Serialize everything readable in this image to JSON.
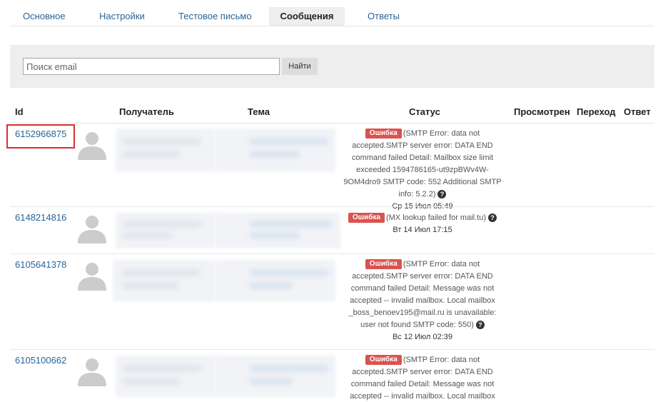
{
  "tabs": [
    {
      "label": "Основное"
    },
    {
      "label": "Настройки"
    },
    {
      "label": "Тестовое письмо"
    },
    {
      "label": "Сообщения"
    },
    {
      "label": "Ответы"
    }
  ],
  "search": {
    "placeholder": "Поиск email",
    "value": "",
    "button_label": "Найти"
  },
  "table": {
    "columns": [
      "Id",
      "Получатель",
      "Тема",
      "Статус",
      "Просмотрен",
      "Переход",
      "Ответ"
    ],
    "rows": [
      {
        "id": "6152966875",
        "badge": "Ошибка",
        "status_text": "(SMTP Error: data not accepted.SMTP server error: DATA END command failed Detail: Mailbox size limit exceeded 1594786165-ut9zpBWv4W-9OM4dro9 SMTP code: 552 Additional SMTP info: 5.2.2)",
        "date": "Ср 15 Июл 05:49"
      },
      {
        "id": "6148214816",
        "badge": "Ошибка",
        "status_text": "(MX lookup failed for mail.tu)",
        "date": "Вт 14 Июл 17:15"
      },
      {
        "id": "6105641378",
        "badge": "Ошибка",
        "status_text": "(SMTP Error: data not accepted.SMTP server error: DATA END command failed Detail: Message was not accepted -- invalid mailbox. Local mailbox _boss_benoev195@mail.ru is unavailable: user not found SMTP code: 550)",
        "date": "Вс 12 Июл 02:39"
      },
      {
        "id": "6105100662",
        "badge": "Ошибка",
        "status_text": "(SMTP Error: data not accepted.SMTP server error: DATA END command failed Detail: Message was not accepted -- invalid mailbox. Local mailbox",
        "date": ""
      }
    ]
  },
  "colors": {
    "link": "#2a6496",
    "badge": "#d9534f",
    "highlight": "#d9312c",
    "panel": "#eeeeee"
  }
}
